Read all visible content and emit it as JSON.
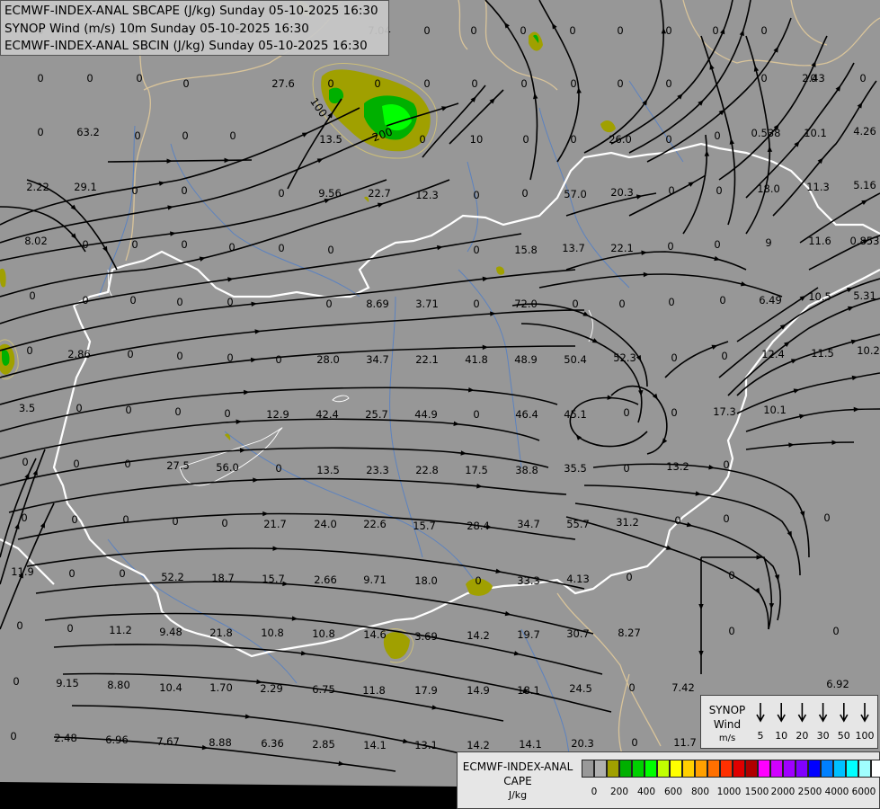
{
  "titles": {
    "line1": "ECMWF-INDEX-ANAL SBCAPE (J/kg) Sunday 05-10-2025 16:30",
    "line2": "SYNOP Wind (m/s) 10m Sunday 05-10-2025 16:30",
    "line3": "ECMWF-INDEX-ANAL SBCIN (J/kg) Sunday 05-10-2025 16:30"
  },
  "colors": {
    "background": "#979797",
    "streamline": "#000000",
    "border": "#ffffff",
    "region_border": "#d9c49a",
    "rivers": "#5c82bf",
    "cape_low": "#a0a000",
    "cape_mid": "#00b000",
    "cape_high": "#00ff00",
    "cin_contour": "#d4c896"
  },
  "map_values": [
    "0",
    "0",
    "0",
    "0",
    "0",
    "7.04",
    "0",
    "0",
    "0",
    "0",
    "0",
    "0",
    "0",
    "0",
    "0",
    "0",
    "0",
    "0",
    "27.6",
    "0",
    "0",
    "0",
    "0",
    "0",
    "0",
    "0",
    "0",
    "0",
    "0",
    "0",
    "2.43",
    "0",
    "63.2",
    "0",
    "0",
    "0",
    "13.5",
    "0",
    "10",
    "0",
    "0",
    "26.0",
    "0",
    "0",
    "0.538",
    "10.1",
    "4.26",
    "2.22",
    "29.1",
    "0",
    "0",
    "0",
    "9.56",
    "22.7",
    "12.3",
    "0",
    "0",
    "57.0",
    "20.3",
    "0",
    "0",
    "18.0",
    "11.3",
    "5.16",
    "8.02",
    "0",
    "0",
    "0",
    "0",
    "0",
    "0",
    "0",
    "15.8",
    "13.7",
    "22.1",
    "0",
    "0",
    "9",
    "11.6",
    "0.853",
    "0",
    "0",
    "0",
    "0",
    "0",
    "0",
    "8.69",
    "3.71",
    "0",
    "72.0",
    "0",
    "0",
    "0",
    "0",
    "6.49",
    "10.5",
    "5.31",
    "0",
    "2.86",
    "0",
    "0",
    "0",
    "0",
    "28.0",
    "34.7",
    "22.1",
    "41.8",
    "48.9",
    "50.4",
    "52.3",
    "0",
    "0",
    "12.4",
    "11.5",
    "10.2",
    "3.5",
    "0",
    "0",
    "0",
    "0",
    "12.9",
    "42.4",
    "25.7",
    "44.9",
    "0",
    "46.4",
    "45.1",
    "0",
    "0",
    "17.3",
    "10.1",
    "0",
    "0",
    "0",
    "27.5",
    "56.0",
    "0",
    "13.5",
    "23.3",
    "22.8",
    "17.5",
    "38.8",
    "35.5",
    "0",
    "13.2",
    "0",
    "0",
    "0",
    "0",
    "0",
    "0",
    "21.7",
    "24.0",
    "22.6",
    "15.7",
    "28.4",
    "34.7",
    "55.7",
    "31.2",
    "0",
    "0",
    "0",
    "11.9",
    "0",
    "0",
    "52.2",
    "18.7",
    "15.7",
    "2.66",
    "9.71",
    "18.0",
    "0",
    "33.3",
    "4.13",
    "0",
    "0",
    "0",
    "0",
    "11.2",
    "9.48",
    "21.8",
    "10.8",
    "10.8",
    "14.6",
    "3.69",
    "14.2",
    "19.7",
    "30.7",
    "8.27",
    "0",
    "0",
    "0",
    "9.15",
    "8.80",
    "10.4",
    "1.70",
    "2.29",
    "6.75",
    "11.8",
    "17.9",
    "14.9",
    "18.1",
    "24.5",
    "0",
    "7.42",
    "6.92",
    "0",
    "2.48",
    "6.96",
    "7.67",
    "8.88",
    "6.36",
    "2.85",
    "14.1",
    "13.1",
    "14.2",
    "14.1",
    "20.3",
    "0",
    "11.7",
    "0",
    "0"
  ],
  "contour_labels": [
    "100",
    "200"
  ],
  "wind_legend": {
    "title": "SYNOP",
    "subtitle": "Wind",
    "unit": "m/s",
    "speeds": [
      "5",
      "10",
      "20",
      "30",
      "50",
      "100"
    ]
  },
  "cape_legend": {
    "title": "ECMWF-INDEX-ANAL",
    "subtitle": "CAPE",
    "unit": "J/kg",
    "ticks": [
      "0",
      "200",
      "400",
      "600",
      "800",
      "1000",
      "1500",
      "2000",
      "2500",
      "4000",
      "6000"
    ],
    "colors": [
      "#999999",
      "#b0b0b0",
      "#a0a000",
      "#00b000",
      "#00d000",
      "#00ff00",
      "#c0ff00",
      "#ffff00",
      "#ffd000",
      "#ffa000",
      "#ff7000",
      "#ff3000",
      "#e00000",
      "#b00000",
      "#ff00ff",
      "#d000ff",
      "#a000ff",
      "#8000ff",
      "#0000ff",
      "#0080ff",
      "#00c0ff",
      "#00ffff",
      "#a0ffff",
      "#ffffff"
    ]
  }
}
